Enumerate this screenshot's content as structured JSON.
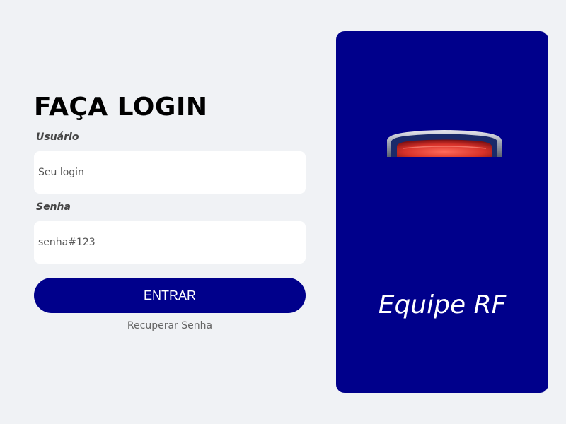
{
  "login": {
    "title": "FAÇA LOGIN",
    "username_label": "Usuário",
    "username_placeholder": "Seu login",
    "password_label": "Senha",
    "password_placeholder": "senha#123",
    "submit_label": "ENTRAR",
    "recover_label": "Recuperar Senha"
  },
  "brand": {
    "name": "Equipe RF",
    "logo_icon": "shield-logo",
    "panel_color": "#00008b"
  },
  "colors": {
    "background": "#f0f2f5",
    "accent": "#00008b",
    "logo_red": "#e53935"
  }
}
